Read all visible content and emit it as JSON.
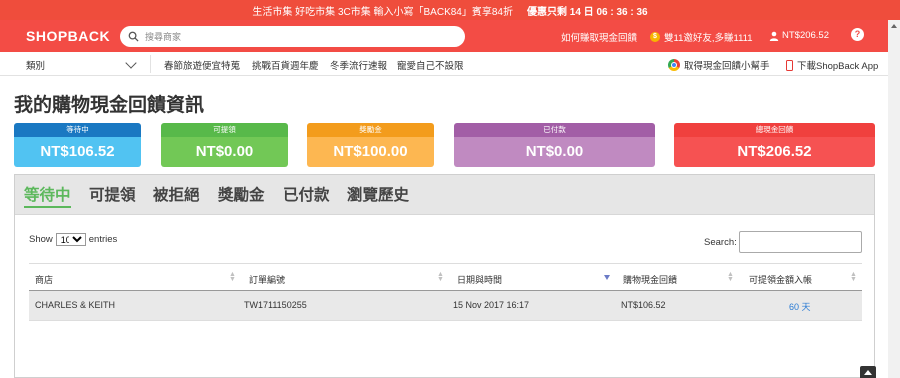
{
  "promo": {
    "text": "生活市集 好吃市集 3C市集 輸入小寫「BACK84」賓享84折",
    "countdown": "優惠只剩 14 日 06 : 36 : 36"
  },
  "header": {
    "logo": "SHOPBACK",
    "search_placeholder": "搜尋商家",
    "how_to": "如何賺取現金回饋",
    "invite": "雙11邀好友,多賺1111",
    "balance": "NT$206.52",
    "help": "?"
  },
  "nav": {
    "category": "類別",
    "links": [
      "春節旅遊便宜特蒐",
      "挑戰百貨週年慶",
      "冬季流行速報",
      "寵愛自己不設限"
    ],
    "extension": "取得現金回饋小幫手",
    "app": "下載ShopBack App"
  },
  "page_title": "我的購物現金回饋資訊",
  "summary_cards": [
    {
      "label": "等待中",
      "value": "NT$106.52",
      "top_color": "#1a78c2",
      "bottom_color": "#51c3f2"
    },
    {
      "label": "可提領",
      "value": "NT$0.00",
      "top_color": "#58b94a",
      "bottom_color": "#72c856"
    },
    {
      "label": "獎勵金",
      "value": "NT$100.00",
      "top_color": "#f39c1c",
      "bottom_color": "#fdb751"
    },
    {
      "label": "已付款",
      "value": "NT$0.00",
      "top_color": "#a25ea6",
      "bottom_color": "#c08ac1"
    },
    {
      "label": "總現金回饋",
      "value": "NT$206.52",
      "top_color": "#f0403e",
      "bottom_color": "#f65252"
    }
  ],
  "tabs": [
    "等待中",
    "可提領",
    "被拒絕",
    "獎勵金",
    "已付款",
    "瀏覽歷史"
  ],
  "table_controls": {
    "show_label": "Show",
    "entries_value": "10",
    "entries_label": "entries",
    "search_label": "Search:"
  },
  "table": {
    "headers": [
      "商店",
      "訂單編號",
      "日期與時間",
      "購物現金回饋",
      "可提領金額入帳"
    ],
    "rows": [
      {
        "store": "CHARLES & KEITH",
        "order_id": "TW1711150255",
        "datetime": "15 Nov 2017 16:17",
        "cashback": "NT$106.52",
        "available_in": "60 天"
      }
    ]
  }
}
